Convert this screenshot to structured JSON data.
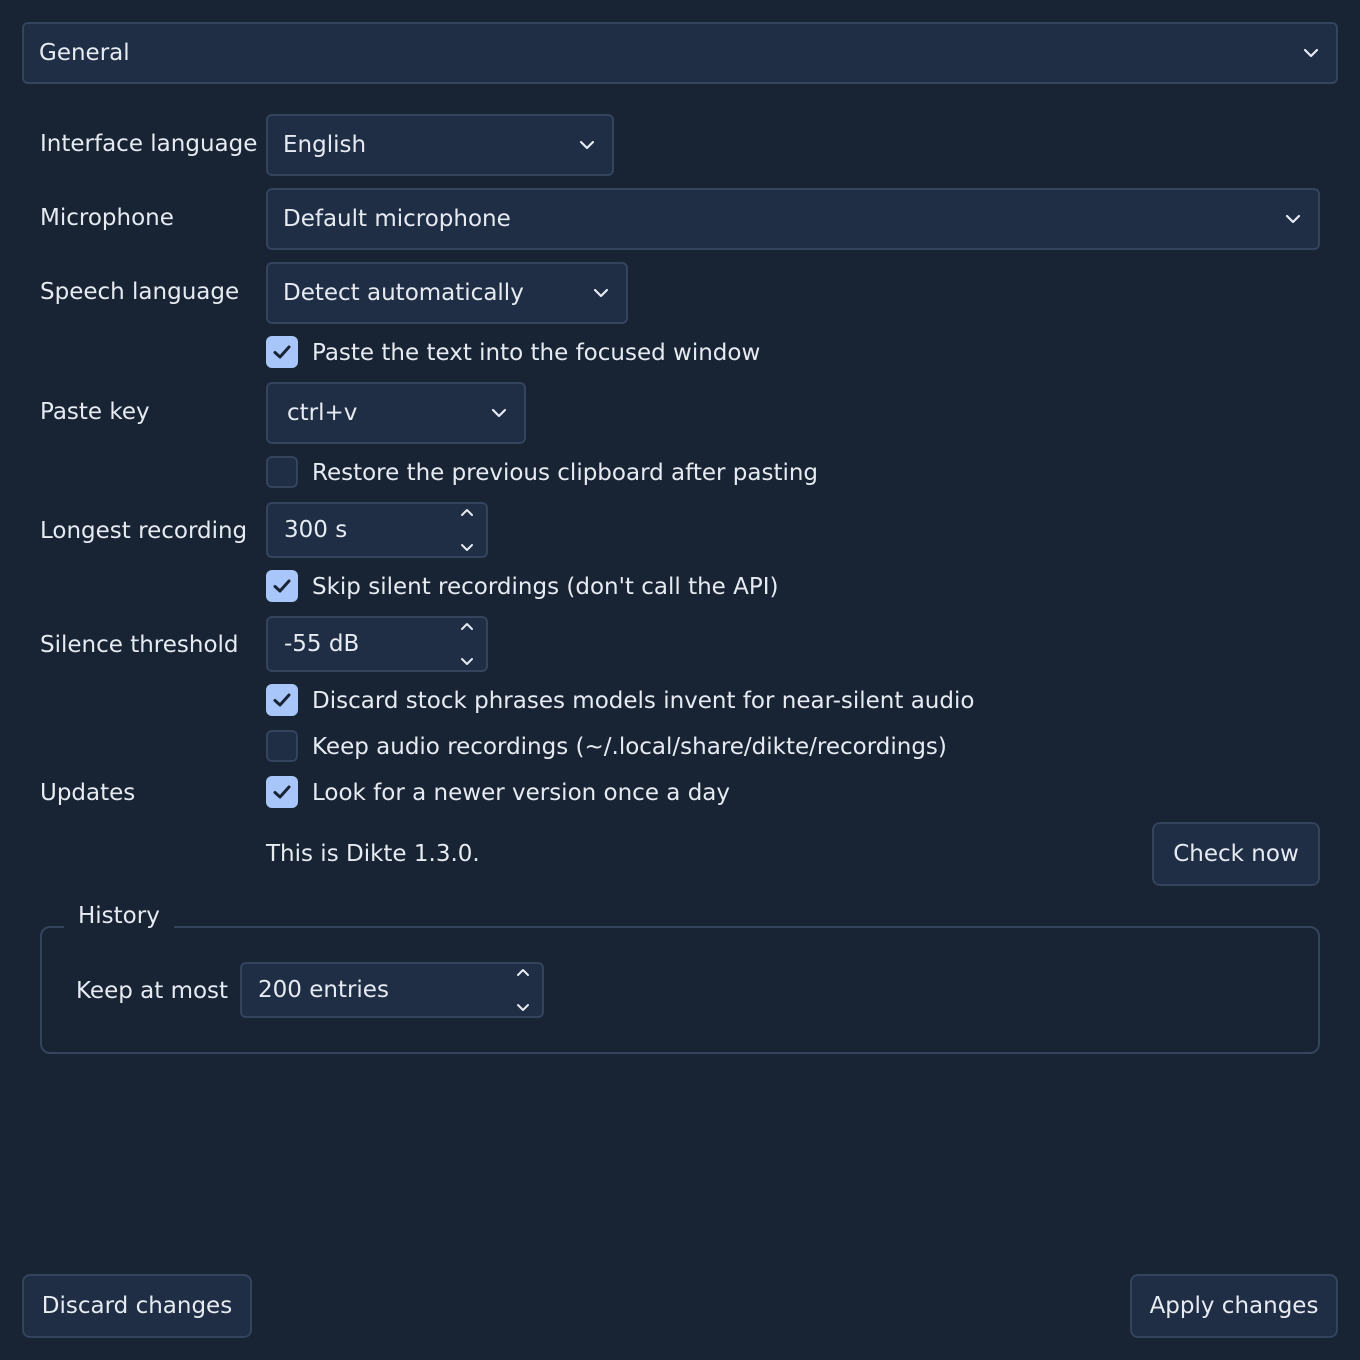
{
  "category": {
    "selected": "General"
  },
  "interface_language": {
    "label": "Interface language",
    "value": "English"
  },
  "microphone": {
    "label": "Microphone",
    "value": "Default microphone"
  },
  "speech_language": {
    "label": "Speech language",
    "value": "Detect automatically"
  },
  "paste_focused": {
    "label": "Paste the text into the focused window",
    "checked": true
  },
  "paste_key": {
    "label": "Paste key",
    "value": "ctrl+v"
  },
  "restore_clipboard": {
    "label": "Restore the previous clipboard after pasting",
    "checked": false
  },
  "longest_recording": {
    "label": "Longest recording",
    "value": "300 s"
  },
  "skip_silent": {
    "label": "Skip silent recordings (don't call the API)",
    "checked": true
  },
  "silence_threshold": {
    "label": "Silence threshold",
    "value": "-55 dB"
  },
  "discard_phrases": {
    "label": "Discard stock phrases models invent for near-silent audio",
    "checked": true
  },
  "keep_audio": {
    "label": "Keep audio recordings (~/.local/share/dikte/recordings)",
    "checked": false
  },
  "updates": {
    "label": "Updates",
    "check_daily_label": "Look for a newer version once a day",
    "check_daily_checked": true,
    "version_text": "This is Dikte 1.3.0.",
    "check_now_label": "Check now"
  },
  "history": {
    "title": "History",
    "keep_label": "Keep at most",
    "keep_value": "200 entries"
  },
  "footer": {
    "discard_label": "Discard changes",
    "apply_label": "Apply changes"
  },
  "colors": {
    "background": "#182334",
    "field": "#1f2d45",
    "border": "#34445c",
    "accent": "#a9c6fb",
    "text": "#e6ebf2"
  },
  "icons": {
    "dropdown": "chevron-down-icon",
    "checkbox": "checkmark-icon",
    "spin_up": "chevron-up-icon",
    "spin_down": "chevron-down-icon"
  }
}
